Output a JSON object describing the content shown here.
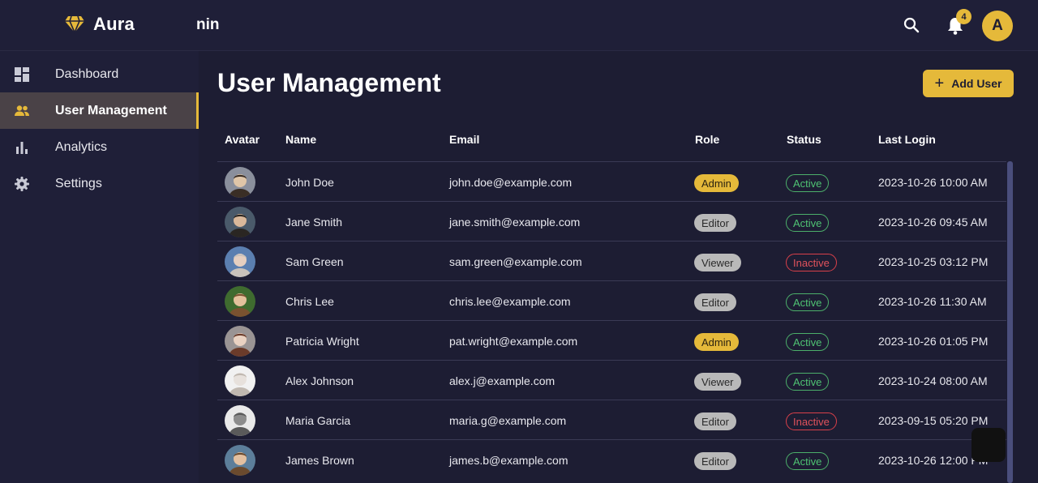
{
  "header": {
    "brand": "Aura",
    "subtitle": "nin",
    "notifications_count": "4",
    "user_initial": "A",
    "accent_color": "#e5b93a"
  },
  "sidebar": {
    "items": [
      {
        "label": "Dashboard",
        "icon": "dashboard-icon",
        "active": false
      },
      {
        "label": "User Management",
        "icon": "users-icon",
        "active": true
      },
      {
        "label": "Analytics",
        "icon": "bar-chart-icon",
        "active": false
      },
      {
        "label": "Settings",
        "icon": "gear-icon",
        "active": false
      }
    ]
  },
  "main": {
    "title": "User Management",
    "add_button_label": "Add User",
    "columns": [
      "Avatar",
      "Name",
      "Email",
      "Role",
      "Status",
      "Last Login"
    ],
    "users": [
      {
        "name": "John Doe",
        "email": "john.doe@example.com",
        "role": "Admin",
        "status": "Active",
        "last_login": "2023-10-26 10:00 AM"
      },
      {
        "name": "Jane Smith",
        "email": "jane.smith@example.com",
        "role": "Editor",
        "status": "Active",
        "last_login": "2023-10-26 09:45 AM"
      },
      {
        "name": "Sam Green",
        "email": "sam.green@example.com",
        "role": "Viewer",
        "status": "Inactive",
        "last_login": "2023-10-25 03:12 PM"
      },
      {
        "name": "Chris Lee",
        "email": "chris.lee@example.com",
        "role": "Editor",
        "status": "Active",
        "last_login": "2023-10-26 11:30 AM"
      },
      {
        "name": "Patricia Wright",
        "email": "pat.wright@example.com",
        "role": "Admin",
        "status": "Active",
        "last_login": "2023-10-26 01:05 PM"
      },
      {
        "name": "Alex Johnson",
        "email": "alex.j@example.com",
        "role": "Viewer",
        "status": "Active",
        "last_login": "2023-10-24 08:00 AM"
      },
      {
        "name": "Maria Garcia",
        "email": "maria.g@example.com",
        "role": "Editor",
        "status": "Inactive",
        "last_login": "2023-09-15 05:20 PM"
      },
      {
        "name": "James Brown",
        "email": "james.b@example.com",
        "role": "Editor",
        "status": "Active",
        "last_login": "2023-10-26 12:00 PM"
      }
    ]
  }
}
